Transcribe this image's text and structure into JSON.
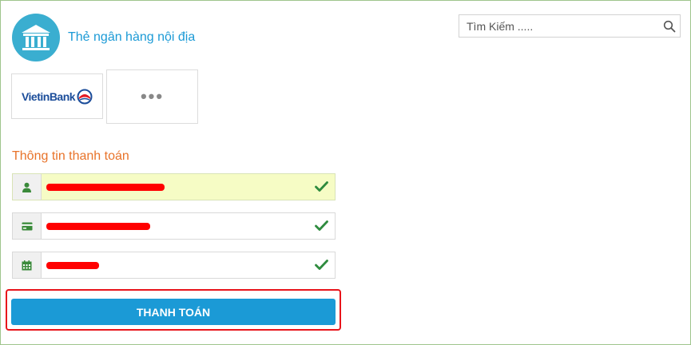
{
  "header": {
    "title": "Thẻ ngân hàng nội địa",
    "icon": "bank-icon"
  },
  "search": {
    "placeholder": "Tìm Kiếm .....",
    "icon": "search-icon"
  },
  "banks": {
    "selected": {
      "name_bold": "Vietin",
      "name_light": "Bank",
      "logo_icon": "vietinbank-logo-icon"
    },
    "more_label": "•••"
  },
  "payment_info": {
    "title": "Thông tin thanh toán",
    "fields": [
      {
        "icon": "user-icon",
        "value": "",
        "valid": true
      },
      {
        "icon": "card-icon",
        "value": "",
        "valid": true
      },
      {
        "icon": "calendar-icon",
        "value": "",
        "valid": true
      }
    ]
  },
  "actions": {
    "pay_label": "THANH TOÁN"
  },
  "colors": {
    "accent": "#1b9ad6",
    "section_title": "#e8732a",
    "check": "#2e8b3e",
    "highlight_field": "#f6fcc5"
  }
}
